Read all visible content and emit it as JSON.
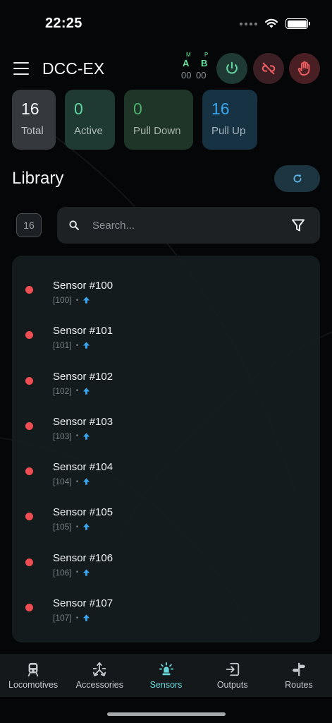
{
  "status_bar": {
    "time": "22:25"
  },
  "header": {
    "title": "DCC-EX",
    "track": {
      "a_sup": "M",
      "a_label": "A",
      "a_value": "00",
      "b_sup": "P",
      "b_label": "B",
      "b_value": "00"
    }
  },
  "stats": [
    {
      "value": "16",
      "label": "Total"
    },
    {
      "value": "0",
      "label": "Active"
    },
    {
      "value": "0",
      "label": "Pull Down"
    },
    {
      "value": "16",
      "label": "Pull Up"
    }
  ],
  "library": {
    "title": "Library",
    "count": "16",
    "search_placeholder": "Search..."
  },
  "sensors": [
    {
      "name": "Sensor #100",
      "id": "[100]"
    },
    {
      "name": "Sensor #101",
      "id": "[101]"
    },
    {
      "name": "Sensor #102",
      "id": "[102]"
    },
    {
      "name": "Sensor #103",
      "id": "[103]"
    },
    {
      "name": "Sensor #104",
      "id": "[104]"
    },
    {
      "name": "Sensor #105",
      "id": "[105]"
    },
    {
      "name": "Sensor #106",
      "id": "[106]"
    },
    {
      "name": "Sensor #107",
      "id": "[107]"
    }
  ],
  "meta_separator": "•",
  "nav": [
    {
      "label": "Locomotives",
      "icon": "train-icon"
    },
    {
      "label": "Accessories",
      "icon": "accessories-icon"
    },
    {
      "label": "Sensors",
      "icon": "sensor-icon",
      "active": true
    },
    {
      "label": "Outputs",
      "icon": "output-icon"
    },
    {
      "label": "Routes",
      "icon": "signpost-icon"
    }
  ],
  "colors": {
    "accent": "#66d6d9",
    "sensor_inactive": "#ee4e52",
    "pull_up_arrow": "#3aa6ef",
    "active_green": "#5fd6a0"
  }
}
